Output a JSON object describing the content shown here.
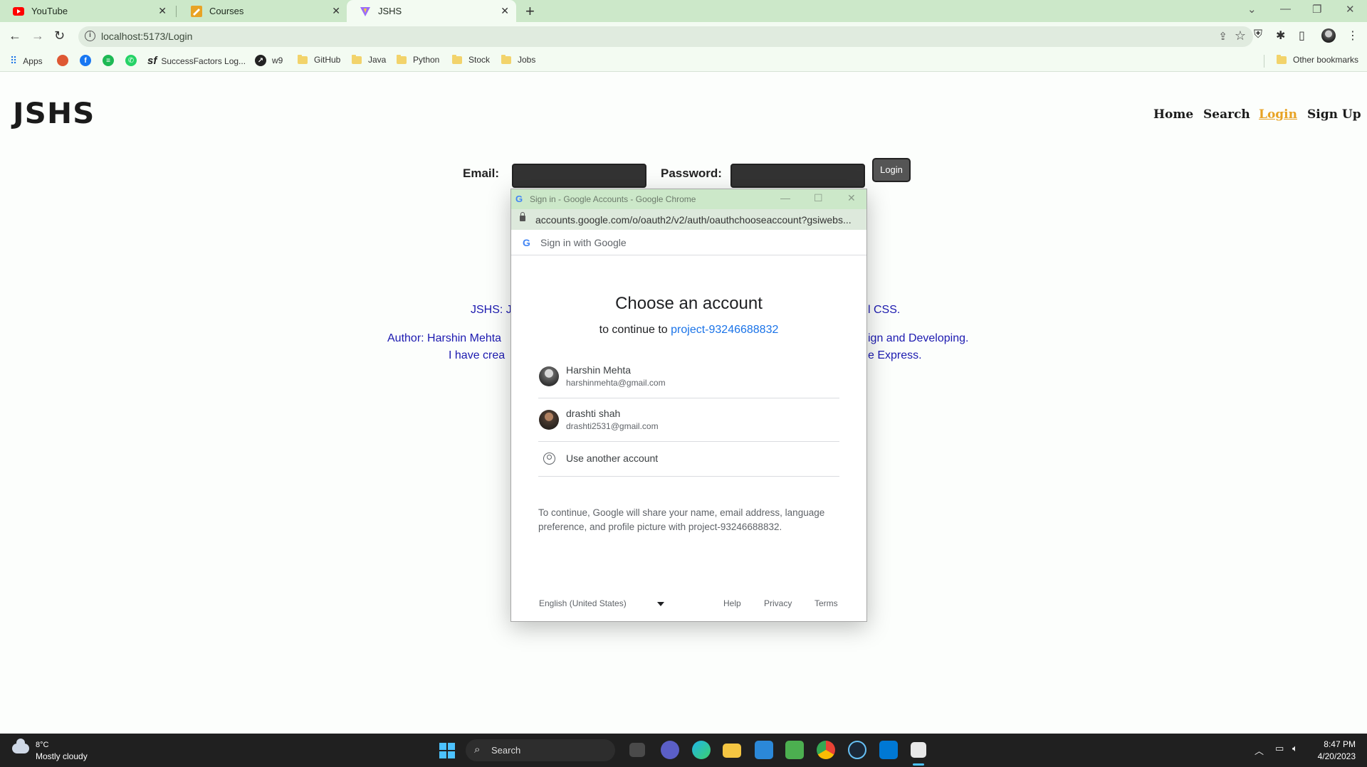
{
  "browser": {
    "tabs": [
      {
        "title": "YouTube",
        "icon": "youtube-icon"
      },
      {
        "title": "Courses",
        "icon": "courses-icon"
      },
      {
        "title": "JSHS",
        "icon": "vite-icon"
      }
    ],
    "url": "localhost:5173/Login",
    "bookmarks": [
      "Apps",
      "SuccessFactors Log...",
      "w9",
      "GitHub",
      "Java",
      "Python",
      "Stock",
      "Jobs"
    ],
    "other_bookmarks": "Other bookmarks"
  },
  "site": {
    "logo": "JSHS",
    "nav": [
      "Home",
      "Search",
      "Login",
      "Sign Up"
    ],
    "active_nav": "Login",
    "email_label": "Email:",
    "password_label": "Password:",
    "login_button": "Login",
    "about": {
      "line1_left": "JSHS: Jo",
      "line1_right": "l CSS.",
      "line2_left": "Author: Harshin Mehta",
      "line2_right": "ign and Developing.",
      "line3_left": "I have crea",
      "line3_right": "e Express."
    }
  },
  "popup": {
    "window_title": "Sign in - Google Accounts - Google Chrome",
    "url": "accounts.google.com/o/oauth2/v2/auth/oauthchooseaccount?gsiwebs...",
    "header": "Sign in with Google",
    "title": "Choose an account",
    "continue_prefix": "to continue to ",
    "project": "project-93246688832",
    "accounts": [
      {
        "name": "Harshin Mehta",
        "email": "harshinmehta@gmail.com"
      },
      {
        "name": "drashti shah",
        "email": "drashti2531@gmail.com"
      }
    ],
    "use_another": "Use another account",
    "consent": "To continue, Google will share your name, email address, language preference, and profile picture with project-93246688832.",
    "language": "English (United States)",
    "footer_links": [
      "Help",
      "Privacy",
      "Terms"
    ]
  },
  "taskbar": {
    "temperature": "8°C",
    "weather": "Mostly cloudy",
    "search": "Search",
    "time": "8:47 PM",
    "date": "4/20/2023"
  },
  "colors": {
    "chrome_frame": "#cce8c9",
    "active_nav": "#e8a325",
    "about_text": "#1c1ab0",
    "google_link": "#1a73e8"
  }
}
